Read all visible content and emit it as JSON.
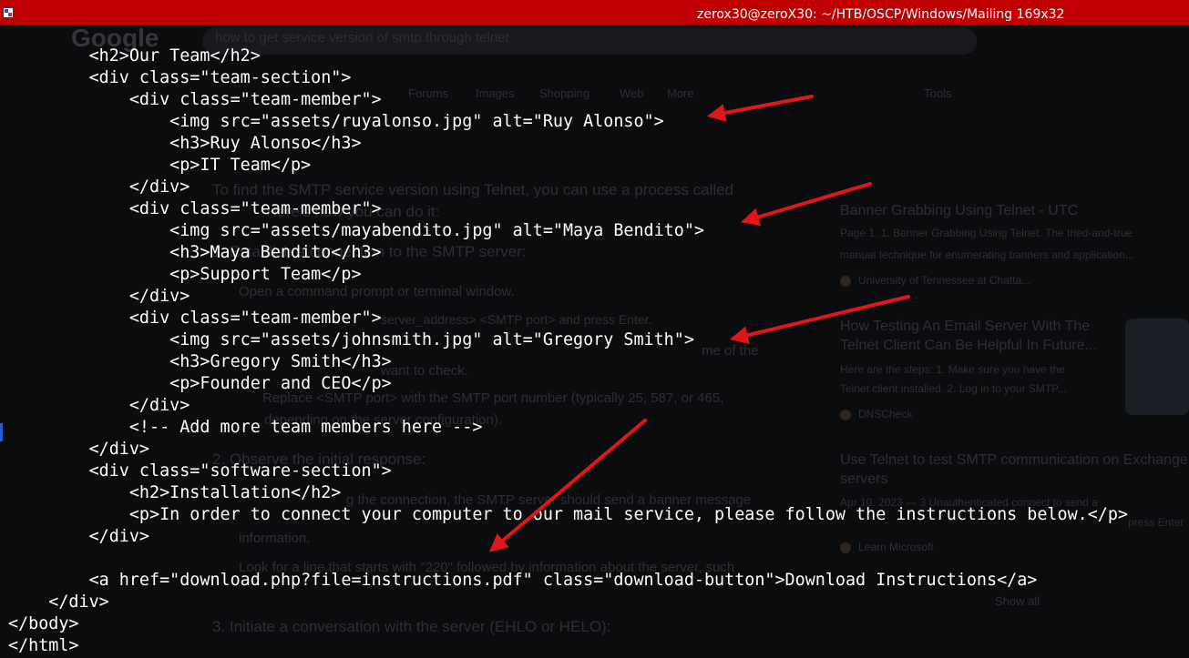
{
  "window": {
    "title": "zerox30@zeroX30: ~/HTB/OSCP/Windows/Mailing 169x32"
  },
  "background_page": {
    "logo": "Google",
    "search_query": "how to get service version of smtp through telnet",
    "tabs": [
      "Forums",
      "Images",
      "Shopping",
      "Web",
      "More",
      "Tools"
    ],
    "answer_lines": [
      "To find the SMTP service version using Telnet, you can use a process called",
      "Here's how you can do it:",
      "1. Establish a connection to the SMTP server:",
      "Open a command prompt or terminal window.",
      "server_address> <SMTP port>  and press Enter.",
      "me of the",
      "want to check.",
      "Replace <SMTP port>  with the SMTP port number (typically 25, 587, or 465,",
      "depending on the server configuration).",
      "2. Observe the initial response:",
      "g the connection, the SMTP server should send a banner message",
      "information.",
      "Look for a line that starts with \"220\" followed by information about the server, such",
      "3. Initiate a conversation with the server (EHLO or HELO):"
    ],
    "results": [
      {
        "title": "Banner Grabbing Using Telnet - UTC",
        "snippet": "Page 1. 1. Banner Grabbing Using Telnet. The tried-and-true",
        "snippet2": "manual technique for enumerating banners and application...",
        "source": "University of Tennessee at Chatta..."
      },
      {
        "title": "How Testing An Email Server With The",
        "title2": "Telnet Client Can Be Helpful In Future...",
        "snippet": "Here are the steps: 1. Make sure you have the",
        "snippet2": "Telnet client installed. 2. Log in to your SMTP...",
        "source": "DNSCheck"
      },
      {
        "title": "Use Telnet to test SMTP communication on Exchange",
        "title2": "servers",
        "snippet": "Apr 10, 2023 — 3 Unauthenticated connect to send a",
        "snippet2": "press Enter",
        "source": "Learn Microsoft"
      }
    ],
    "show_all": "Show all"
  },
  "code_lines": [
    "        <h2>Our Team</h2>",
    "        <div class=\"team-section\">",
    "            <div class=\"team-member\">",
    "                <img src=\"assets/ruyalonso.jpg\" alt=\"Ruy Alonso\">",
    "                <h3>Ruy Alonso</h3>",
    "                <p>IT Team</p>",
    "            </div>",
    "            <div class=\"team-member\">",
    "                <img src=\"assets/mayabendito.jpg\" alt=\"Maya Bendito\">",
    "                <h3>Maya Bendito</h3>",
    "                <p>Support Team</p>",
    "            </div>",
    "            <div class=\"team-member\">",
    "                <img src=\"assets/johnsmith.jpg\" alt=\"Gregory Smith\">",
    "                <h3>Gregory Smith</h3>",
    "                <p>Founder and CEO</p>",
    "            </div>",
    "            <!-- Add more team members here -->",
    "        </div>",
    "        <div class=\"software-section\">",
    "            <h2>Installation</h2>",
    "            <p>In order to connect your computer to our mail service, please follow the instructions below.</p>",
    "        </div>",
    "",
    "        <a href=\"download.php?file=instructions.pdf\" class=\"download-button\">Download Instructions</a>",
    "    </div>",
    "</body>",
    "</html>"
  ],
  "colors": {
    "titlebar": "#c00000",
    "terminal_bg": "#0b0c0e",
    "text": "#ffffff",
    "annotation_arrow": "#e0161b"
  }
}
